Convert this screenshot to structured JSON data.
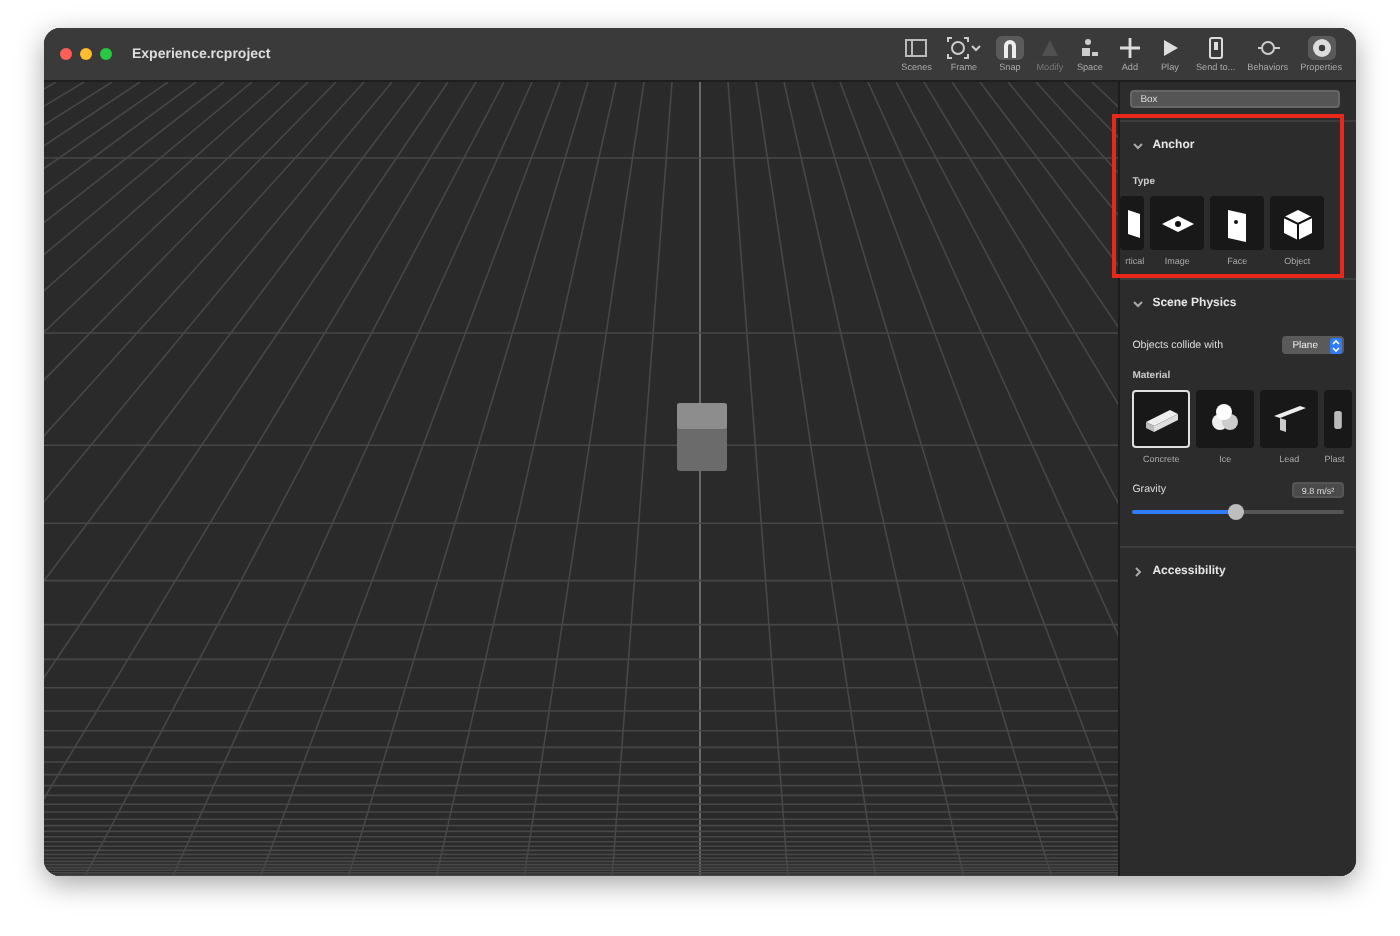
{
  "window": {
    "title": "Experience.rcproject"
  },
  "toolbar": [
    {
      "label": "Scenes",
      "active": false,
      "disabled": false
    },
    {
      "label": "Frame",
      "active": false,
      "disabled": false
    },
    {
      "label": "Snap",
      "active": true,
      "disabled": false
    },
    {
      "label": "Modify",
      "active": false,
      "disabled": true
    },
    {
      "label": "Space",
      "active": false,
      "disabled": false
    },
    {
      "label": "Add",
      "active": false,
      "disabled": false
    },
    {
      "label": "Play",
      "active": false,
      "disabled": false
    },
    {
      "label": "Send to...",
      "active": false,
      "disabled": false
    },
    {
      "label": "Behaviors",
      "active": false,
      "disabled": false
    },
    {
      "label": "Properties",
      "active": true,
      "disabled": false
    }
  ],
  "panel": {
    "name_field": {
      "value": "Box"
    },
    "anchor": {
      "title": "Anchor",
      "expanded": true,
      "type_label": "Type",
      "types": [
        {
          "label": "rtical"
        },
        {
          "label": "Image"
        },
        {
          "label": "Face"
        },
        {
          "label": "Object"
        }
      ]
    },
    "scene_physics": {
      "title": "Scene Physics",
      "expanded": true,
      "collide_label": "Objects collide with",
      "collide_value": "Plane",
      "material_label": "Material",
      "materials": [
        {
          "label": "Concrete",
          "selected": true
        },
        {
          "label": "Ice",
          "selected": false
        },
        {
          "label": "Lead",
          "selected": false
        },
        {
          "label": "Plast",
          "selected": false
        }
      ],
      "gravity_label": "Gravity",
      "gravity_value": "9.8 m/s²",
      "gravity_slider": {
        "level": 0.49
      }
    },
    "accessibility": {
      "title": "Accessibility",
      "expanded": false
    }
  }
}
